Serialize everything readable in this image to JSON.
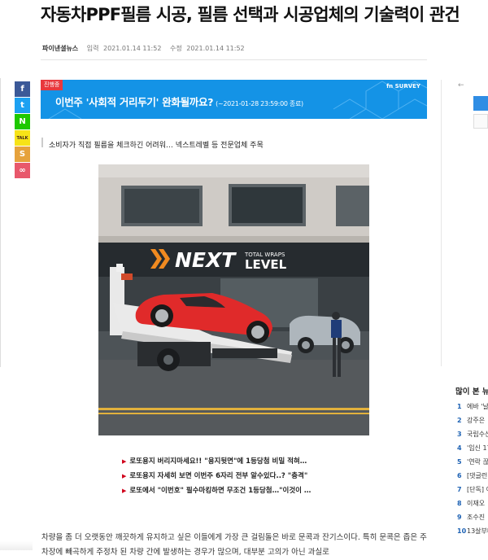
{
  "article": {
    "headline": "자동차PPF필름 시공, 필름 선택과 시공업체의 기술력이 관건",
    "source": "파이낸셜뉴스",
    "input_label": "입력",
    "input_time": "2021.01.14 11:52",
    "modified_label": "수정",
    "modified_time": "2021.01.14 11:52",
    "subtitle": "소비자가 직접 필름을 체크하긴 어려워… 넥스트레벨 등 전문업체 주목",
    "body_text": "차량을 좀 더 오랫동안 깨끗하게 유지하고 싶은 이들에게 가장 큰 걸림돌은 바로 문콕과 잔기스이다. 특히 문콕은 좁은 주차장에 빼곡하게 주정차 된 차량 간에 발생하는 경우가 많으며, 대부분 고의가 아닌 과실로"
  },
  "share": {
    "facebook": "f",
    "twitter": "t",
    "naver": "N",
    "kakaotalk": "TALK",
    "kakaostory": "S",
    "link": "∞"
  },
  "banner": {
    "badge": "진행중",
    "text": "이번주 '사회적 거리두기' 완화될까요?",
    "date": "(~2021-01-28 23:59:00 종료)",
    "brand": "fn SURVEY"
  },
  "photo": {
    "sign_main": "NEXT",
    "sign_sub": "LEVEL",
    "sign_small": "TOTAL WRAPS"
  },
  "related_links": [
    "로또용지 버리지마세요!! \"용지뒷면\"에 1등당첨 비밀 적혀…",
    "로또용지 자세히 보면 이번주 6자리 전부 알수있다..? \"충격\"",
    "로또에서 \"이번호\" 필수마킹하면 무조건 1등당첨…\"이것이 …"
  ],
  "right_sidebar": {
    "back_arrow": "←",
    "popular_title": "많이 본 뉴",
    "popular_items": [
      {
        "num": "1",
        "text": "에바 '날"
      },
      {
        "num": "2",
        "text": "강주은"
      },
      {
        "num": "3",
        "text": "국립수산"
      },
      {
        "num": "4",
        "text": "'임신 17"
      },
      {
        "num": "5",
        "text": "'연락 끊"
      },
      {
        "num": "6",
        "text": "[댓글런"
      },
      {
        "num": "7",
        "text": "[단독] 이"
      },
      {
        "num": "8",
        "text": "이재오"
      },
      {
        "num": "9",
        "text": "조수진"
      },
      {
        "num": "10",
        "text": "13살부터"
      }
    ]
  },
  "colors": {
    "banner": "#1493e6",
    "badge": "#e8383d",
    "accent_red": "#d0021b",
    "link_blue": "#1f63b4"
  }
}
